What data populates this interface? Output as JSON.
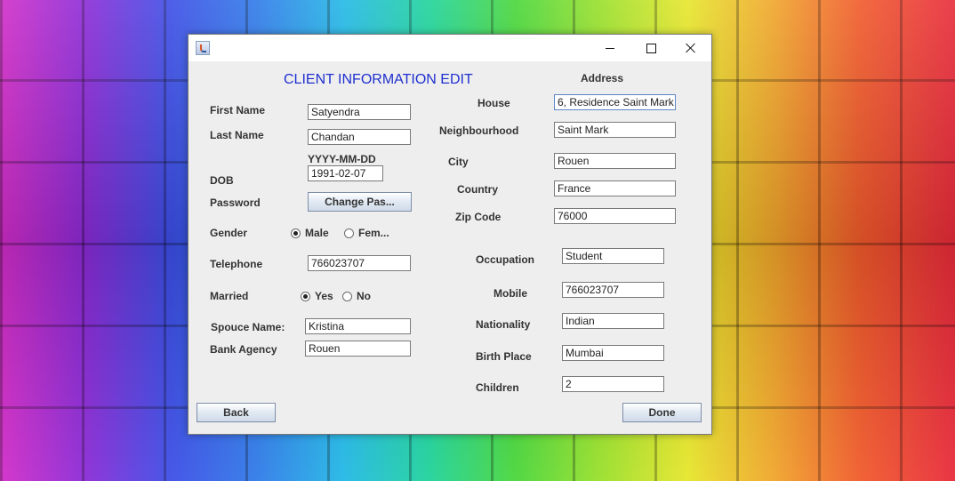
{
  "form": {
    "title": "CLIENT INFORMATION EDIT",
    "first_name": {
      "label": "First Name",
      "value": "Satyendra"
    },
    "last_name": {
      "label": "Last Name",
      "value": "Chandan"
    },
    "dob": {
      "label": "DOB",
      "hint": "YYYY-MM-DD",
      "value": "1991-02-07"
    },
    "password": {
      "label": "Password",
      "button": "Change Pas..."
    },
    "gender": {
      "label": "Gender",
      "options": [
        "Male",
        "Fem..."
      ],
      "selected": "Male"
    },
    "telephone": {
      "label": "Telephone",
      "value": "766023707"
    },
    "married": {
      "label": "Married",
      "options": [
        "Yes",
        "No"
      ],
      "selected": "Yes"
    },
    "spouse_name": {
      "label": "Spouce Name:",
      "value": "Kristina"
    },
    "bank_agency": {
      "label": "Bank Agency",
      "value": "Rouen"
    }
  },
  "address": {
    "header": "Address",
    "house": {
      "label": "House",
      "value": "6, Residence Saint Mark"
    },
    "neighbourhood": {
      "label": "Neighbourhood",
      "value": "Saint Mark"
    },
    "city": {
      "label": "City",
      "value": "Rouen"
    },
    "country": {
      "label": "Country",
      "value": "France"
    },
    "zip_code": {
      "label": "Zip Code",
      "value": "76000"
    }
  },
  "personal": {
    "occupation": {
      "label": "Occupation",
      "value": "Student"
    },
    "mobile": {
      "label": "Mobile",
      "value": "766023707"
    },
    "nationality": {
      "label": "Nationality",
      "value": "Indian"
    },
    "birth_place": {
      "label": "Birth Place",
      "value": "Mumbai"
    },
    "children": {
      "label": "Children",
      "value": "2"
    }
  },
  "buttons": {
    "back": "Back",
    "done": "Done"
  },
  "colors": {
    "title": "#1f2fd0",
    "window_bg": "#eeeeee"
  },
  "icons": {
    "app": "java-cup-icon",
    "minimize": "minimize-icon",
    "maximize": "maximize-icon",
    "close": "close-icon"
  }
}
